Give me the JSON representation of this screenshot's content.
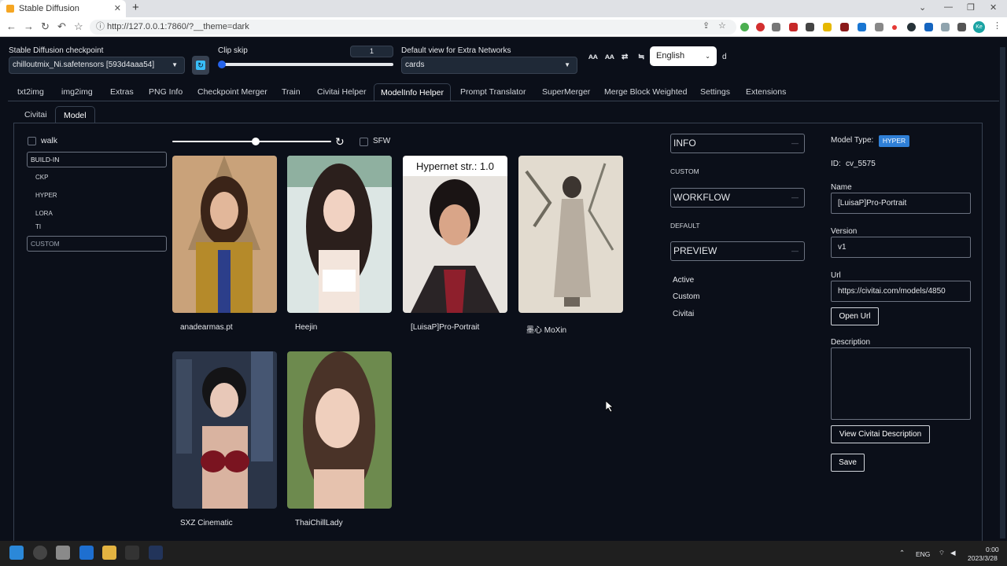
{
  "browser": {
    "tab_title": "Stable Diffusion",
    "url": "http://127.0.0.1:7860/?__theme=dark",
    "profile_initials": "Ke"
  },
  "top": {
    "checkpoint_label": "Stable Diffusion checkpoint",
    "checkpoint_value": "chilloutmix_Ni.safetensors [593d4aaa54]",
    "clip_skip_label": "Clip skip",
    "clip_skip_value": "1",
    "extra_view_label": "Default view for Extra Networks",
    "extra_view_value": "cards",
    "language": "English",
    "trailing_text": "d"
  },
  "main_tabs": [
    "txt2img",
    "img2img",
    "Extras",
    "PNG Info",
    "Checkpoint Merger",
    "Train",
    "Civitai Helper",
    "ModelInfo Helper",
    "Prompt Translator",
    "SuperMerger",
    "Merge Block Weighted",
    "Settings",
    "Extensions"
  ],
  "main_tab_selected": "ModelInfo Helper",
  "sub_tabs": [
    "Civitai",
    "Model"
  ],
  "sub_tab_selected": "Model",
  "left": {
    "walk_label": "walk",
    "build_in": "BUILD-IN",
    "categories": [
      "CKP",
      "HYPER",
      "LORA",
      "TI"
    ],
    "custom": "CUSTOM"
  },
  "gallery": {
    "sfw_label": "SFW",
    "hypernet_overlay": "Hypernet str.: 1.0",
    "cards": [
      {
        "name": "anadearmas.pt"
      },
      {
        "name": "Heejin"
      },
      {
        "name": "[LuisaP]Pro-Portrait"
      },
      {
        "name": "墨心 MoXin"
      },
      {
        "name": "SXZ Cinematic"
      },
      {
        "name": "ThaiChillLady"
      }
    ]
  },
  "middle": {
    "info": "INFO",
    "custom": "CUSTOM",
    "workflow": "WORKFLOW",
    "default": "DEFAULT",
    "preview": "PREVIEW",
    "filters": [
      "Active",
      "Custom",
      "Civitai"
    ]
  },
  "details": {
    "model_type_label": "Model Type:",
    "model_type": "HYPER",
    "id_label": "ID:",
    "id_value": "cv_5575",
    "name_label": "Name",
    "name_value": "[LuisaP]Pro-Portrait",
    "version_label": "Version",
    "version_value": "v1",
    "url_label": "Url",
    "url_value": "https://civitai.com/models/4850",
    "open_url": "Open Url",
    "description_label": "Description",
    "view_desc": "View Civitai Description",
    "save": "Save"
  },
  "taskbar": {
    "lang": "ENG",
    "time": "0:00",
    "date": "2023/3/28"
  }
}
